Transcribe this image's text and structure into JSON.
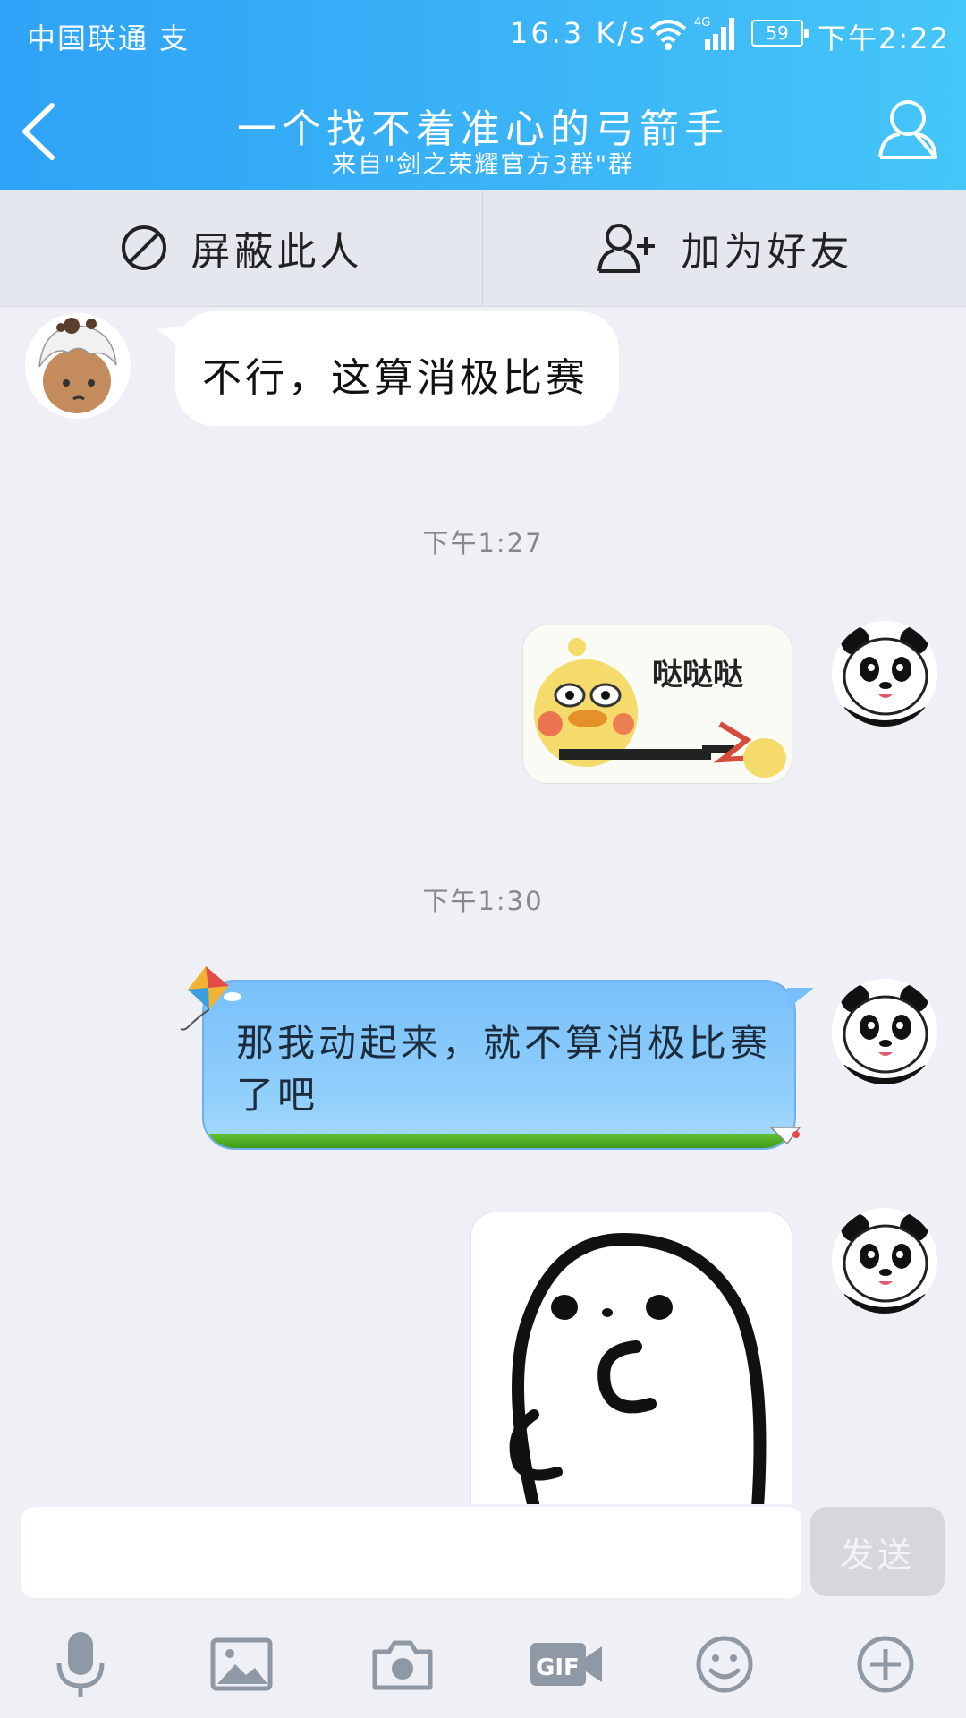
{
  "status_bar": {
    "carrier": "中国联通 支",
    "speed": "16.3 K/s",
    "network": "4G",
    "battery": "59",
    "time": "下午2:22"
  },
  "header": {
    "title": "一个找不着准心的弓箭手",
    "subtitle": "来自\"剑之荣耀官方3群\"群"
  },
  "actions": {
    "block_label": "屏蔽此人",
    "add_friend_label": "加为好友"
  },
  "messages": [
    {
      "sender": "other",
      "type": "text",
      "text": "不行，这算消极比赛"
    },
    {
      "type": "timestamp",
      "text": "下午1:27"
    },
    {
      "sender": "me",
      "type": "sticker",
      "caption": "哒哒哒"
    },
    {
      "type": "timestamp",
      "text": "下午1:30"
    },
    {
      "sender": "me",
      "type": "text",
      "text": "那我动起来，就不算消极比赛了吧"
    },
    {
      "sender": "me",
      "type": "sticker"
    }
  ],
  "input": {
    "placeholder": "",
    "send_label": "发送"
  },
  "toolbar": [
    "microphone-icon",
    "image-icon",
    "camera-icon",
    "gif-icon",
    "emoji-icon",
    "plus-icon"
  ],
  "colors": {
    "header_start": "#2fa2f7",
    "header_end": "#45c6f8",
    "background": "#eff0f5",
    "bubble_blue": "#8ccbfb"
  }
}
